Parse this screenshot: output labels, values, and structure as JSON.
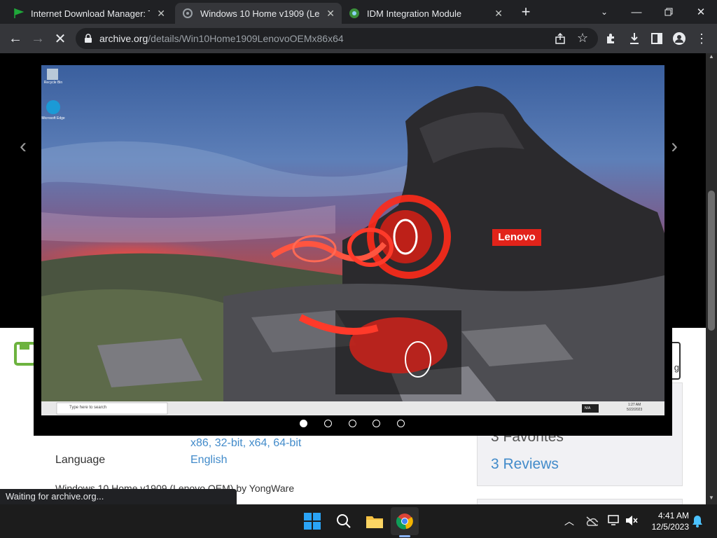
{
  "tabs": [
    {
      "title": "Internet Download Manager: Th",
      "icon": "green-flag-icon"
    },
    {
      "title": "Windows 10 Home v1909 (Leno",
      "icon": "archive-icon",
      "active": true
    },
    {
      "title": "IDM Integration Module",
      "icon": "idm-icon"
    }
  ],
  "toolbar": {
    "url_host": "archive.org",
    "url_path": "/details/Win10Home1909LenovoOEMx86x64"
  },
  "slideshow": {
    "desktop_icons": [
      "Recycle Bin",
      "Microsoft Edge"
    ],
    "brand": "Lenovo",
    "search_placeholder": "Type here to search",
    "lang_badge": "N/A",
    "time": "1:27 AM",
    "date": "5/22/2023",
    "dots": 5,
    "active_dot": 1
  },
  "metadata": {
    "arch_links": "x86, 32-bit, x64, 64-bit",
    "language_label": "Language",
    "language_value": "English",
    "description": "Windows 10 Home v1909 (Lenovo OEM) by YongWare"
  },
  "stats": {
    "favorites": "3 Favorites",
    "reviews": "3 Reviews"
  },
  "status_text": "Waiting for archive.org...",
  "taskbar": {
    "time": "4:41 AM",
    "date": "12/5/2023"
  },
  "colors": {
    "chrome_dark": "#202124",
    "toolbar": "#35363a",
    "link": "#428bca",
    "save_green": "#6db33f",
    "lenovo_red": "#e2231a"
  }
}
